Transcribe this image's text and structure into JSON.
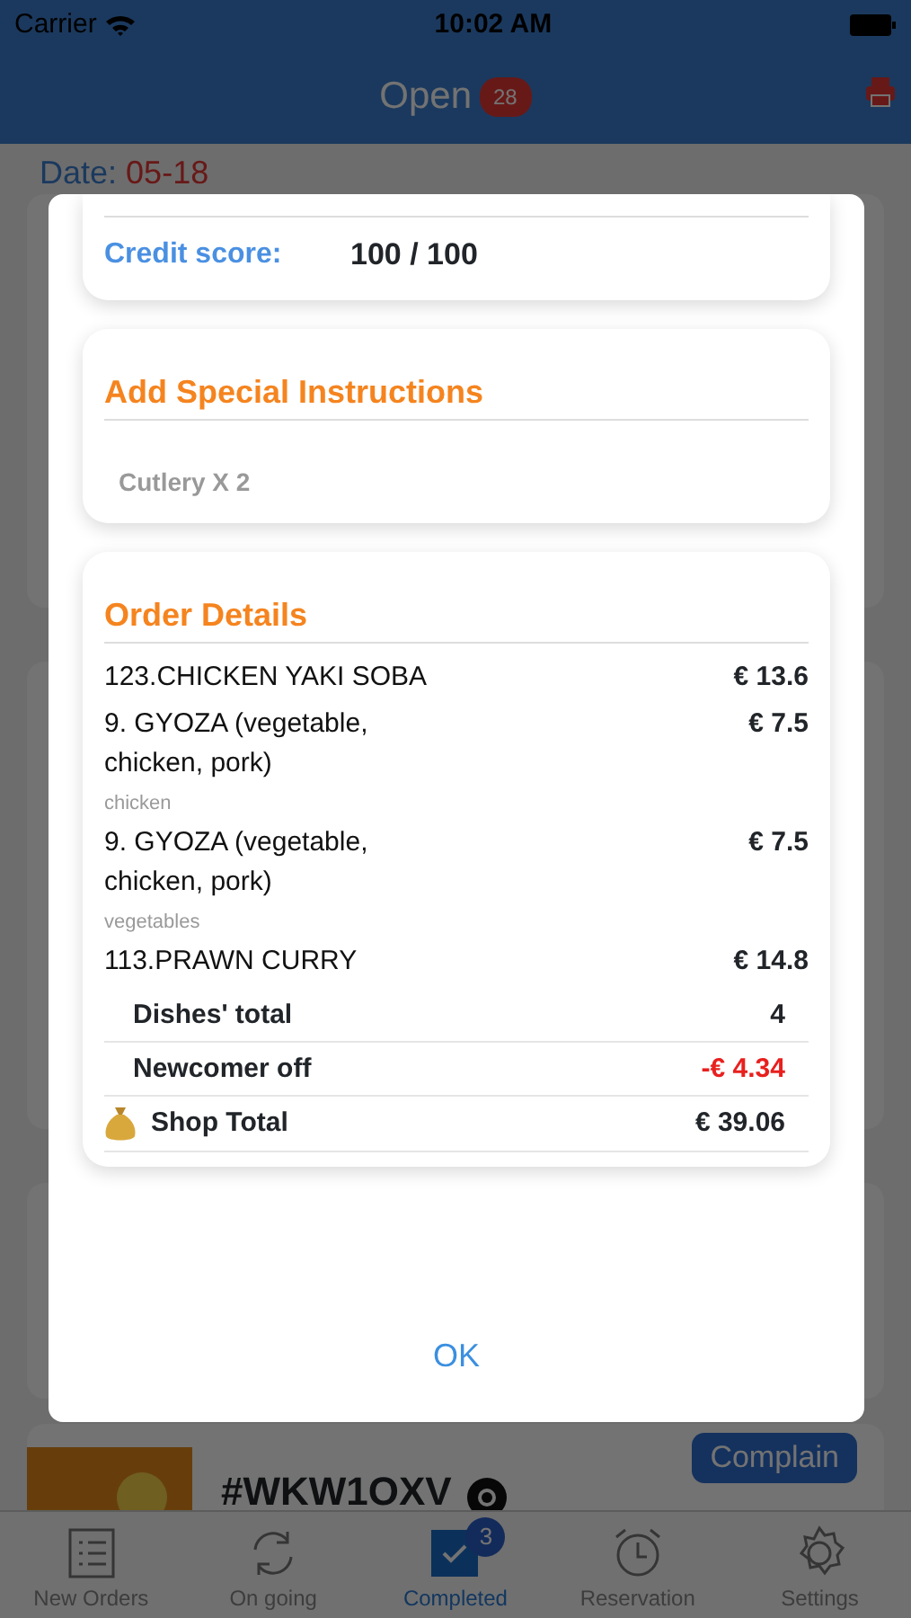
{
  "status_bar": {
    "carrier": "Carrier",
    "time": "10:02 AM"
  },
  "nav": {
    "title": "Open",
    "badge": "28"
  },
  "date": {
    "label": "Date:",
    "value": "05-18"
  },
  "modal": {
    "credit": {
      "label": "Credit score:",
      "value": "100 / 100"
    },
    "instructions": {
      "title": "Add Special Instructions",
      "text": "Cutlery X 2"
    },
    "order": {
      "title": "Order Details",
      "items": [
        {
          "name": "123.CHICKEN YAKI SOBA",
          "price": "€ 13.6"
        },
        {
          "name": "9. GYOZA (vegetable, chicken, pork)",
          "price": "€ 7.5",
          "note": "chicken"
        },
        {
          "name": "9. GYOZA (vegetable, chicken, pork)",
          "price": "€ 7.5",
          "note": "vegetables"
        },
        {
          "name": "113.PRAWN CURRY",
          "price": "€ 14.8"
        }
      ],
      "summary": [
        {
          "kind": "count",
          "label": "Dishes' total",
          "value": "4"
        },
        {
          "kind": "discount",
          "label": "Newcomer off",
          "value": "-€ 4.34"
        },
        {
          "kind": "total",
          "label": "Shop Total",
          "value": "€ 39.06"
        }
      ]
    },
    "ok": "OK"
  },
  "background_order": {
    "code": "#WKW1OXV",
    "complain": "Complain"
  },
  "tabs": [
    {
      "kind": "list",
      "label": "New Orders",
      "selected": false
    },
    {
      "kind": "refresh",
      "label": "On going",
      "selected": false
    },
    {
      "kind": "check",
      "label": "Completed",
      "selected": true,
      "badge": "3"
    },
    {
      "kind": "alarm",
      "label": "Reservation",
      "selected": false
    },
    {
      "kind": "gear",
      "label": "Settings",
      "selected": false
    }
  ]
}
